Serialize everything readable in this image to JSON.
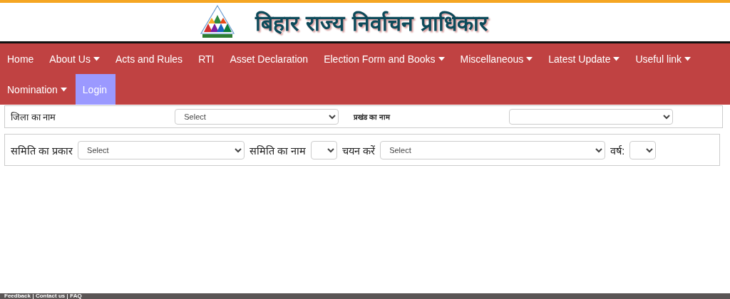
{
  "header": {
    "title": "बिहार राज्य निर्वाचन प्राधिकार"
  },
  "nav": [
    {
      "label": "Home",
      "dropdown": false,
      "selected": false
    },
    {
      "label": "About Us",
      "dropdown": true,
      "selected": false
    },
    {
      "label": "Acts and Rules",
      "dropdown": false,
      "selected": false
    },
    {
      "label": "RTI",
      "dropdown": false,
      "selected": false
    },
    {
      "label": "Asset Declaration",
      "dropdown": false,
      "selected": false
    },
    {
      "label": "Election Form and Books",
      "dropdown": true,
      "selected": false
    },
    {
      "label": "Miscellaneous",
      "dropdown": true,
      "selected": false
    },
    {
      "label": "Latest Update",
      "dropdown": true,
      "selected": false
    },
    {
      "label": "Useful link",
      "dropdown": true,
      "selected": false
    },
    {
      "label": "Nomination",
      "dropdown": true,
      "selected": false
    },
    {
      "label": "Login",
      "dropdown": false,
      "selected": true
    }
  ],
  "panels": [
    {
      "fields": [
        {
          "label": "जिला का नाम",
          "value": "Select"
        },
        {
          "label": "प्रखंड का नाम"
        }
      ]
    },
    {
      "fields": [
        {
          "label": "समिति का प्रकार",
          "value": "Select"
        },
        {
          "label": "समिति का नाम"
        },
        {
          "label": "चयन करें",
          "value": "Select"
        },
        {
          "label": "वर्ष:"
        }
      ]
    }
  ],
  "footer": {
    "links": [
      "Feedback",
      "Contact us",
      "FAQ"
    ]
  }
}
